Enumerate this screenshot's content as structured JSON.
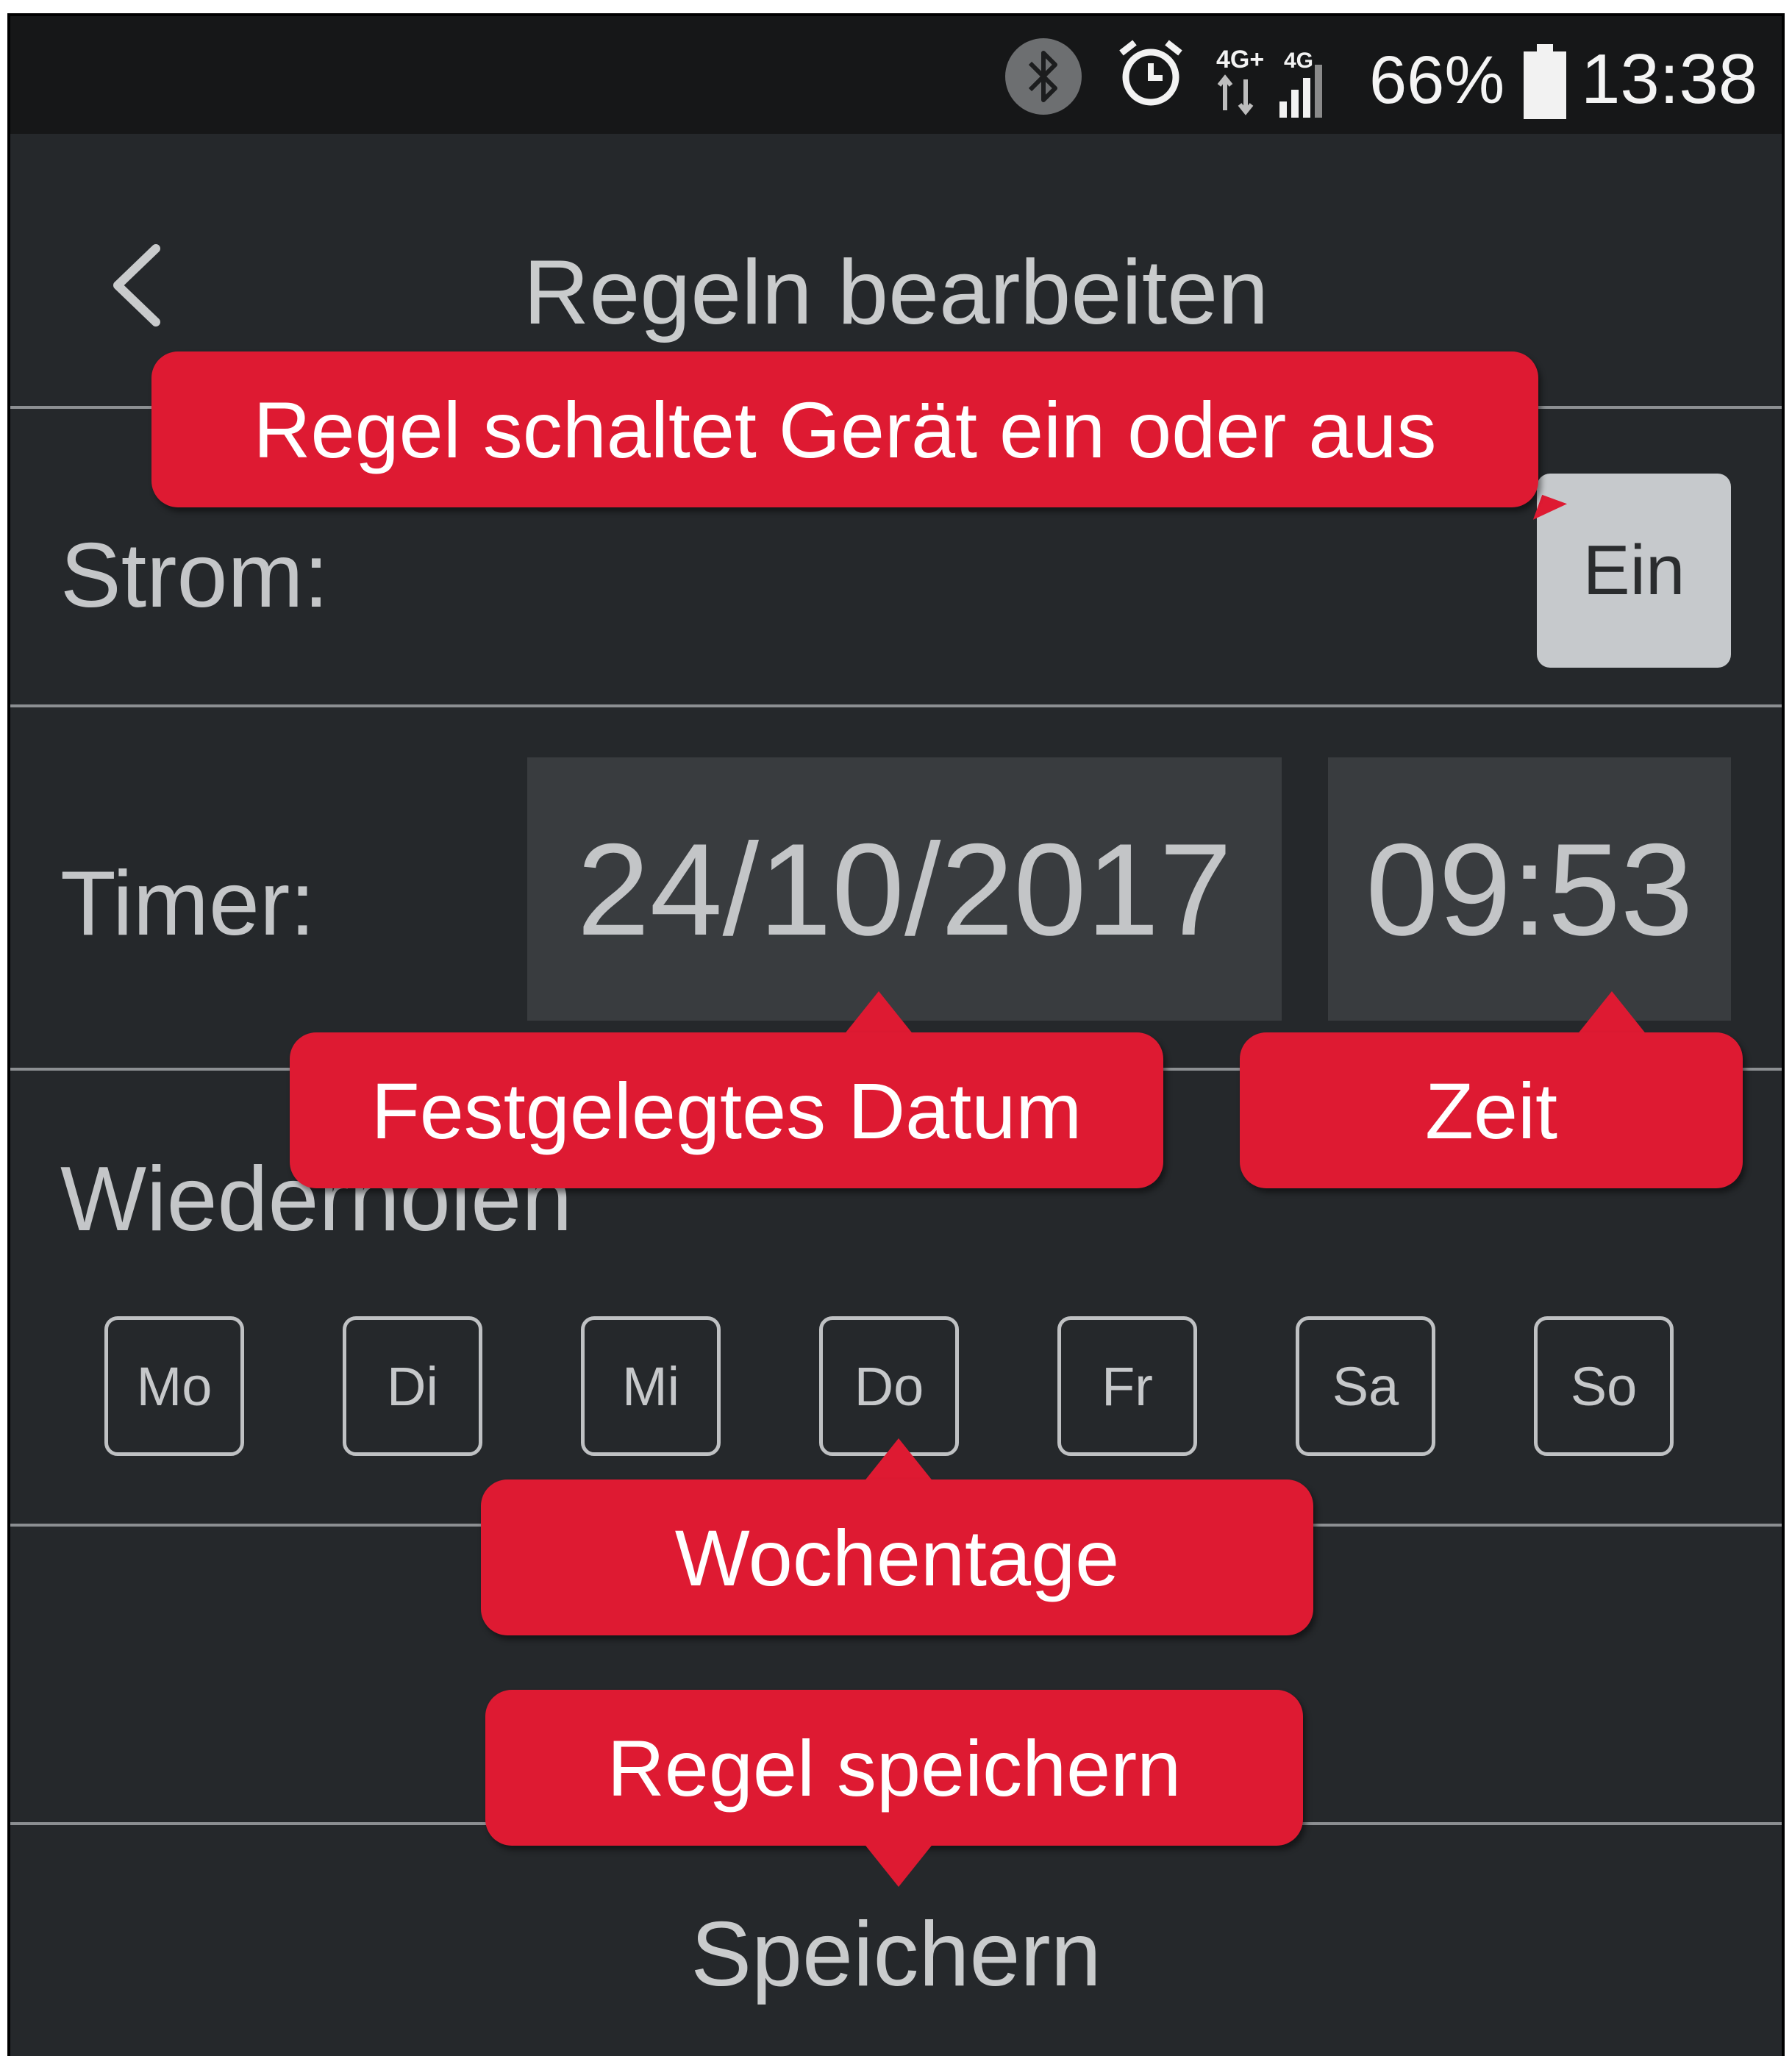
{
  "status_bar": {
    "network_primary": "4G+",
    "network_secondary": "4G",
    "battery": "66%",
    "time": "13:38",
    "icons": [
      "bluetooth-icon",
      "alarm-icon",
      "signal-icon",
      "battery-icon"
    ]
  },
  "header": {
    "title": "Regeln bearbeiten",
    "back_icon": "chevron-left-icon"
  },
  "power": {
    "label": "Strom:",
    "value": "Ein"
  },
  "timer": {
    "label": "Timer:",
    "date": "24/10/2017",
    "time": "09:53"
  },
  "repeat": {
    "label": "Wiederholen",
    "days": [
      "Mo",
      "Di",
      "Mi",
      "Do",
      "Fr",
      "Sa",
      "So"
    ]
  },
  "save": {
    "label": "Speichern"
  },
  "callouts": {
    "power": "Regel schaltet Gerät ein oder aus",
    "date": "Festgelegtes Datum",
    "time": "Zeit",
    "weekdays": "Wochentage",
    "save": "Regel speichern"
  },
  "colors": {
    "background": "#25282b",
    "status_bar": "#161718",
    "callout": "#de1a32",
    "field": "#393c3f",
    "button": "#c6c9cc"
  }
}
